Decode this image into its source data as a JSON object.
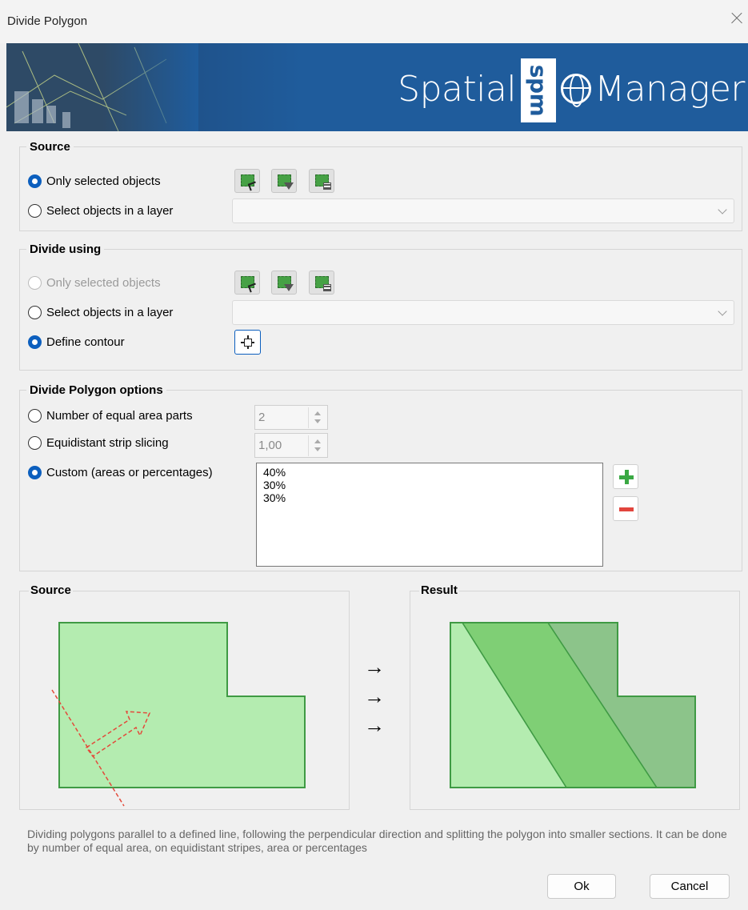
{
  "window": {
    "title": "Divide Polygon"
  },
  "banner": {
    "brand_left": "Spatial",
    "brand_logo": "spm",
    "brand_right": "Manager"
  },
  "source_group": {
    "legend": "Source",
    "options": [
      {
        "label": "Only selected objects",
        "checked": true
      },
      {
        "label": "Select objects in a layer",
        "checked": false
      }
    ],
    "tools": [
      "select-objects-icon",
      "filter-objects-icon",
      "table-objects-icon"
    ],
    "layer_combo": {
      "value": ""
    }
  },
  "divide_group": {
    "legend": "Divide using",
    "options": [
      {
        "label": "Only selected objects",
        "checked": false,
        "disabled": true
      },
      {
        "label": "Select objects in a layer",
        "checked": false
      },
      {
        "label": "Define contour",
        "checked": true
      }
    ],
    "tools": [
      "select-objects-icon",
      "filter-objects-icon",
      "table-objects-icon",
      "crosshair-icon"
    ],
    "layer_combo": {
      "value": ""
    }
  },
  "options_group": {
    "legend": "Divide Polygon options",
    "options": [
      {
        "label": "Number of equal area parts",
        "checked": false,
        "value": "2"
      },
      {
        "label": "Equidistant strip slicing",
        "checked": false,
        "value": "1,00"
      },
      {
        "label": "Custom (areas or percentages)",
        "checked": true
      }
    ],
    "custom_values": [
      "40%",
      "30%",
      "30%"
    ],
    "list_buttons": [
      "plus-icon",
      "minus-icon"
    ]
  },
  "preview": {
    "source_title": "Source",
    "result_title": "Result",
    "arrows": [
      "→",
      "→",
      "→"
    ],
    "colors": {
      "light": "#b4ecb0",
      "mid": "#7fcf75",
      "dark": "#8cc48a",
      "outline": "#3f9a44",
      "cut_line": "#e34a3b"
    }
  },
  "description": "Dividing polygons parallel to a defined line, following the perpendicular direction and splitting the polygon into smaller sections. It can be done by number of equal area, on equidistant stripes, area or percentages",
  "footer": {
    "ok": "Ok",
    "cancel": "Cancel"
  }
}
